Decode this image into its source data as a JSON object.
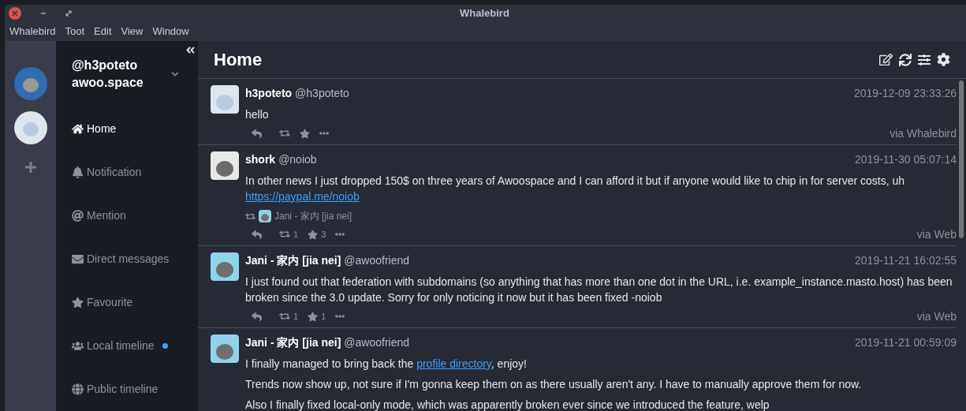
{
  "window": {
    "title": "Whalebird"
  },
  "menu": [
    "Whalebird",
    "Toot",
    "Edit",
    "View",
    "Window"
  ],
  "accounts": [
    {
      "kind": "dog"
    },
    {
      "kind": "elephant"
    }
  ],
  "account_header": {
    "handle": "@h3poteto",
    "domain": "awoo.space"
  },
  "nav": [
    {
      "kind": "home",
      "label": "Home",
      "selected": true,
      "unread": false
    },
    {
      "kind": "bell",
      "label": "Notification",
      "selected": false,
      "unread": false
    },
    {
      "kind": "at",
      "label": "Mention",
      "selected": false,
      "unread": false
    },
    {
      "kind": "envelope",
      "label": "Direct messages",
      "selected": false,
      "unread": false
    },
    {
      "kind": "star",
      "label": "Favourite",
      "selected": false,
      "unread": false
    },
    {
      "kind": "users",
      "label": "Local timeline",
      "selected": false,
      "unread": true
    },
    {
      "kind": "globe",
      "label": "Public timeline",
      "selected": false,
      "unread": false
    }
  ],
  "header": {
    "title": "Home"
  },
  "posts": [
    {
      "kind": "elephant",
      "name": "h3poteto",
      "handle": "@h3poteto",
      "time": "2019-12-09 23:33:26",
      "paragraphs": [
        [
          {
            "kind": "text",
            "text": "hello"
          }
        ]
      ],
      "via": "via Whalebird"
    },
    {
      "kind": "shark",
      "name": "shork",
      "handle": "@noiob",
      "time": "2019-11-30 05:07:14",
      "paragraphs": [
        [
          {
            "kind": "text",
            "text": "In other news I just dropped 150$ on three years of Awoospace and I can afford it but if anyone would like to chip in for server costs, uh "
          },
          {
            "kind": "link",
            "text": "https://paypal.me/noiob"
          }
        ]
      ],
      "reblogged_by": "Jani - 家内 [jia nei]",
      "reblogs": "1",
      "favourites": "3",
      "via": "via Web"
    },
    {
      "kind": "wolf",
      "name": "Jani - 家内 [jia nei]",
      "handle": "@awoofriend",
      "time": "2019-11-21 16:02:55",
      "paragraphs": [
        [
          {
            "kind": "text",
            "text": "I just found out that federation with subdomains (so anything that has more than one dot in the URL, i.e. example_instance.masto.host) has been broken since the 3.0 update. Sorry for only noticing it now but it has been fixed -noiob"
          }
        ]
      ],
      "reblogs": "1",
      "favourites": "1",
      "via": "via Web"
    },
    {
      "kind": "wolf",
      "name": "Jani - 家内 [jia nei]",
      "handle": "@awoofriend",
      "time": "2019-11-21 00:59:09",
      "paragraphs": [
        [
          {
            "kind": "text",
            "text": "I finally managed to bring back the "
          },
          {
            "kind": "link",
            "text": "profile directory"
          },
          {
            "kind": "text",
            "text": ", enjoy!"
          }
        ],
        [
          {
            "kind": "text",
            "text": "Trends now show up, not sure if I'm gonna keep them on as there usually aren't any. I have to manually approve them for now."
          }
        ],
        [
          {
            "kind": "text",
            "text": "Also I finally fixed local-only mode, which was apparently broken ever since we introduced the feature, welp"
          }
        ]
      ]
    }
  ]
}
